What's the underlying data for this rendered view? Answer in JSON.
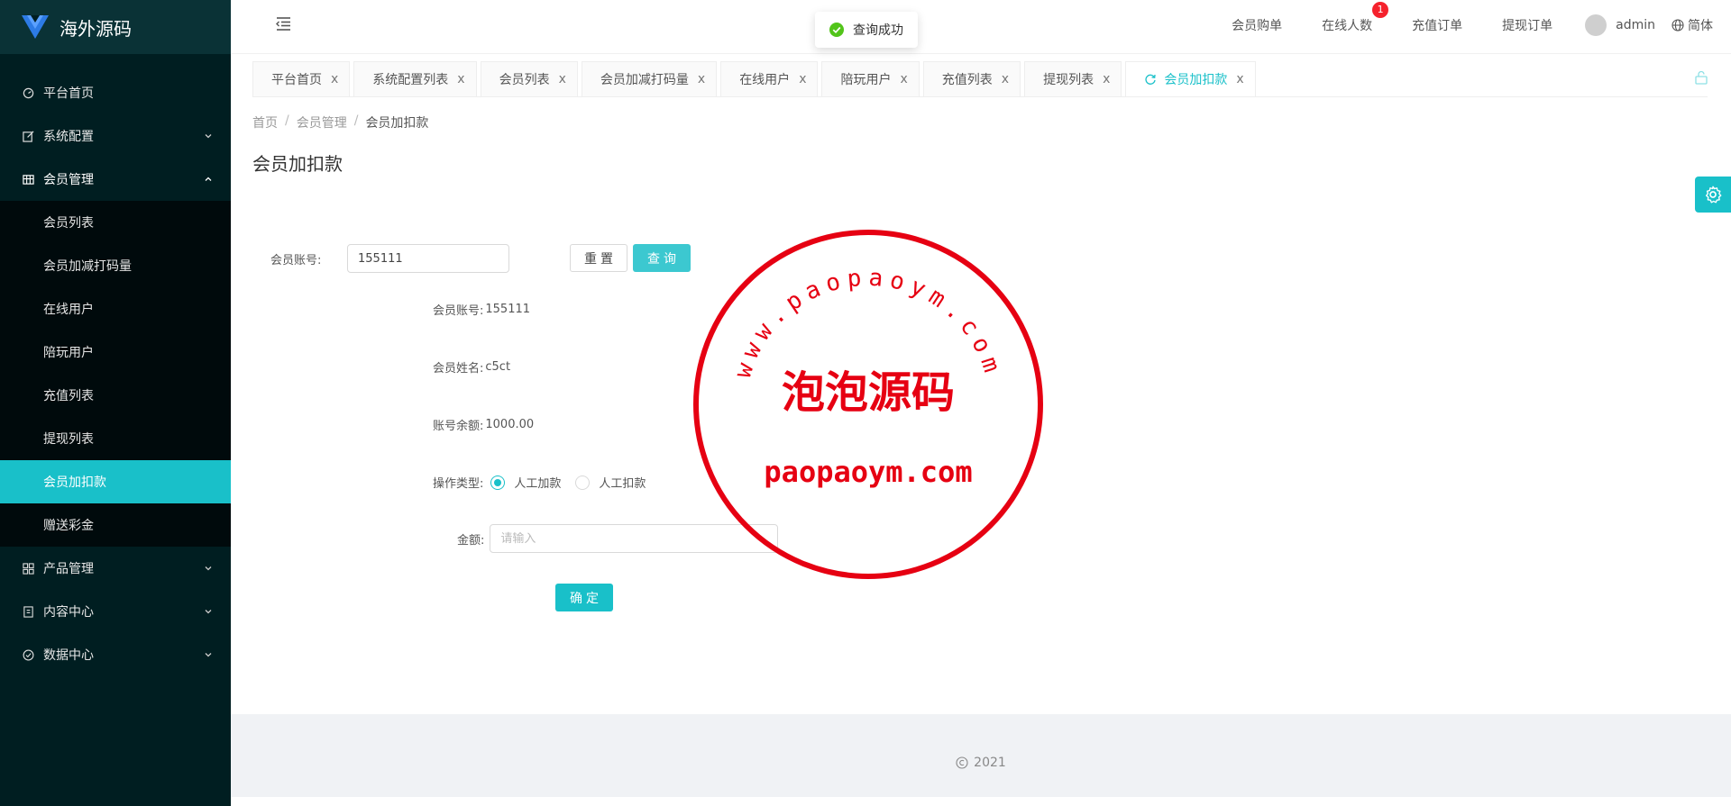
{
  "app": {
    "logo_text": "海外源码"
  },
  "sidebar": {
    "menu": [
      {
        "label": "平台首页",
        "icon": "dashboard-icon"
      },
      {
        "label": "系统配置",
        "icon": "edit-icon"
      },
      {
        "label": "会员管理",
        "icon": "table-icon"
      }
    ],
    "member_sub": [
      {
        "label": "会员列表"
      },
      {
        "label": "会员加减打码量"
      },
      {
        "label": "在线用户"
      },
      {
        "label": "陪玩用户"
      },
      {
        "label": "充值列表"
      },
      {
        "label": "提现列表"
      },
      {
        "label": "会员加扣款"
      },
      {
        "label": "赠送彩金"
      }
    ],
    "menu_after": [
      {
        "label": "产品管理",
        "icon": "grid-icon"
      },
      {
        "label": "内容中心",
        "icon": "document-icon"
      },
      {
        "label": "数据中心",
        "icon": "check-circle-icon"
      }
    ]
  },
  "header": {
    "links": [
      "会员购单",
      "在线人数",
      "充值订单",
      "提现订单"
    ],
    "online_badge": "1",
    "username": "admin",
    "language": "简体"
  },
  "toast": {
    "text": "查询成功"
  },
  "tabs": [
    {
      "label": "平台首页"
    },
    {
      "label": "系统配置列表"
    },
    {
      "label": "会员列表"
    },
    {
      "label": "会员加减打码量"
    },
    {
      "label": "在线用户"
    },
    {
      "label": "陪玩用户"
    },
    {
      "label": "充值列表"
    },
    {
      "label": "提现列表"
    },
    {
      "label": "会员加扣款"
    }
  ],
  "tab_close": "x",
  "breadcrumb": {
    "items": [
      "首页",
      "会员管理",
      "会员加扣款"
    ],
    "sep": "/"
  },
  "page": {
    "title": "会员加扣款"
  },
  "search": {
    "label": "会员账号:",
    "value": "155111",
    "reset": "重置",
    "query": "查询"
  },
  "detail": {
    "account_label": "会员账号:",
    "account_value": "155111",
    "name_label": "会员姓名:",
    "name_value": "c5ct",
    "balance_label": "账号余额:",
    "balance_value": "1000.00",
    "op_label": "操作类型:",
    "op_options": [
      "人工加款",
      "人工扣款"
    ],
    "op_selected": "人工加款",
    "amount_label": "金额:",
    "amount_placeholder": "请输入",
    "confirm": "确定"
  },
  "footer": {
    "text": "2021"
  },
  "watermark": {
    "top_arc": "www.paopaoym.com",
    "center": "泡泡源码",
    "bottom": "paopaoym.com",
    "color": "#e60012"
  },
  "colors": {
    "accent": "#19c0c9",
    "sidebar_bg": "#001e21",
    "badge": "#f5222d"
  }
}
